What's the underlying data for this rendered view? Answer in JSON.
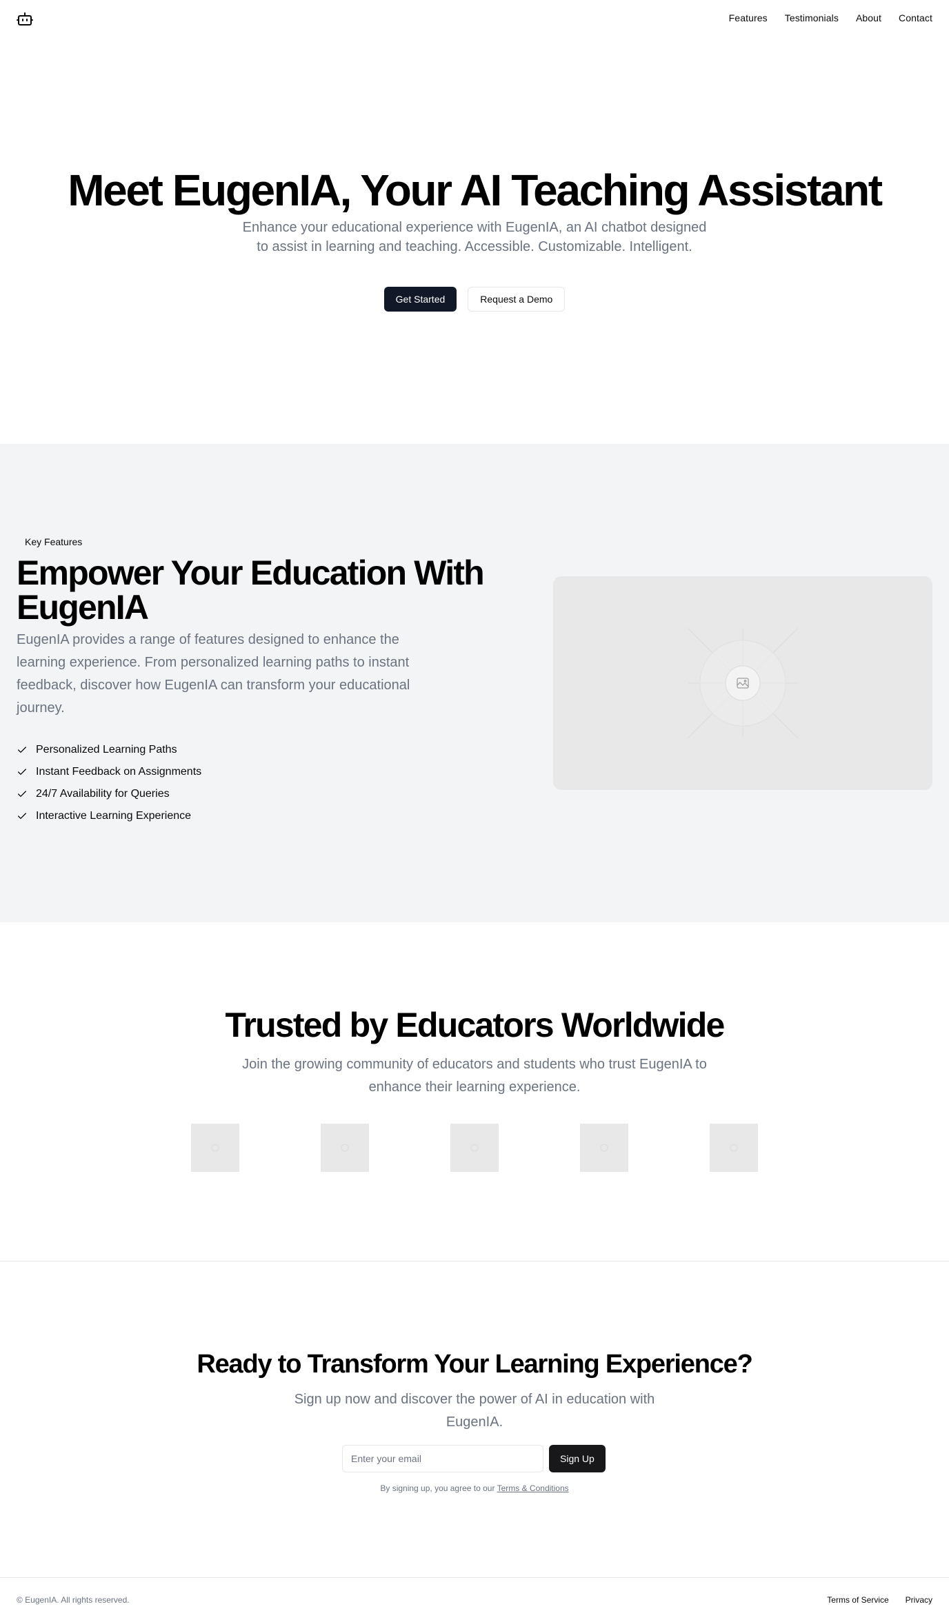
{
  "header": {
    "logo_icon": "bot-icon",
    "nav": [
      {
        "label": "Features"
      },
      {
        "label": "Testimonials"
      },
      {
        "label": "About"
      },
      {
        "label": "Contact"
      }
    ]
  },
  "hero": {
    "title": "Meet EugenIA, Your AI Teaching Assistant",
    "subtitle": "Enhance your educational experience with EugenIA, an AI chatbot designed to assist in learning and teaching. Accessible. Customizable. Intelligent.",
    "primary_button": "Get Started",
    "secondary_button": "Request a Demo"
  },
  "features": {
    "badge": "Key Features",
    "title": "Empower Your Education With EugenIA",
    "description": "EugenIA provides a range of features designed to enhance the learning experience. From personalized learning paths to instant feedback, discover how EugenIA can transform your educational journey.",
    "items": [
      {
        "label": "Personalized Learning Paths",
        "icon": "check-icon"
      },
      {
        "label": "Instant Feedback on Assignments",
        "icon": "check-icon"
      },
      {
        "label": "24/7 Availability for Queries",
        "icon": "check-icon"
      },
      {
        "label": "Interactive Learning Experience",
        "icon": "check-icon"
      }
    ],
    "image_icon": "image-placeholder-icon"
  },
  "trusted": {
    "title": "Trusted by Educators Worldwide",
    "subtitle": "Join the growing community of educators and students who trust EugenIA to enhance their learning experience.",
    "logos": [
      "logo-placeholder-icon",
      "logo-placeholder-icon",
      "logo-placeholder-icon",
      "logo-placeholder-icon",
      "logo-placeholder-icon"
    ]
  },
  "cta": {
    "title": "Ready to Transform Your Learning Experience?",
    "subtitle": "Sign up now and discover the power of AI in education with EugenIA.",
    "email_placeholder": "Enter your email",
    "button": "Sign Up",
    "terms_prefix": "By signing up, you agree to our ",
    "terms_link": "Terms & Conditions"
  },
  "footer": {
    "copyright": "© EugenIA. All rights reserved.",
    "links": [
      {
        "label": "Terms of Service"
      },
      {
        "label": "Privacy"
      }
    ]
  },
  "colors": {
    "primary_dark": "#111827",
    "muted_text": "#6b7280",
    "section_bg": "#f3f4f6",
    "placeholder_bg": "#e8e8e8"
  }
}
